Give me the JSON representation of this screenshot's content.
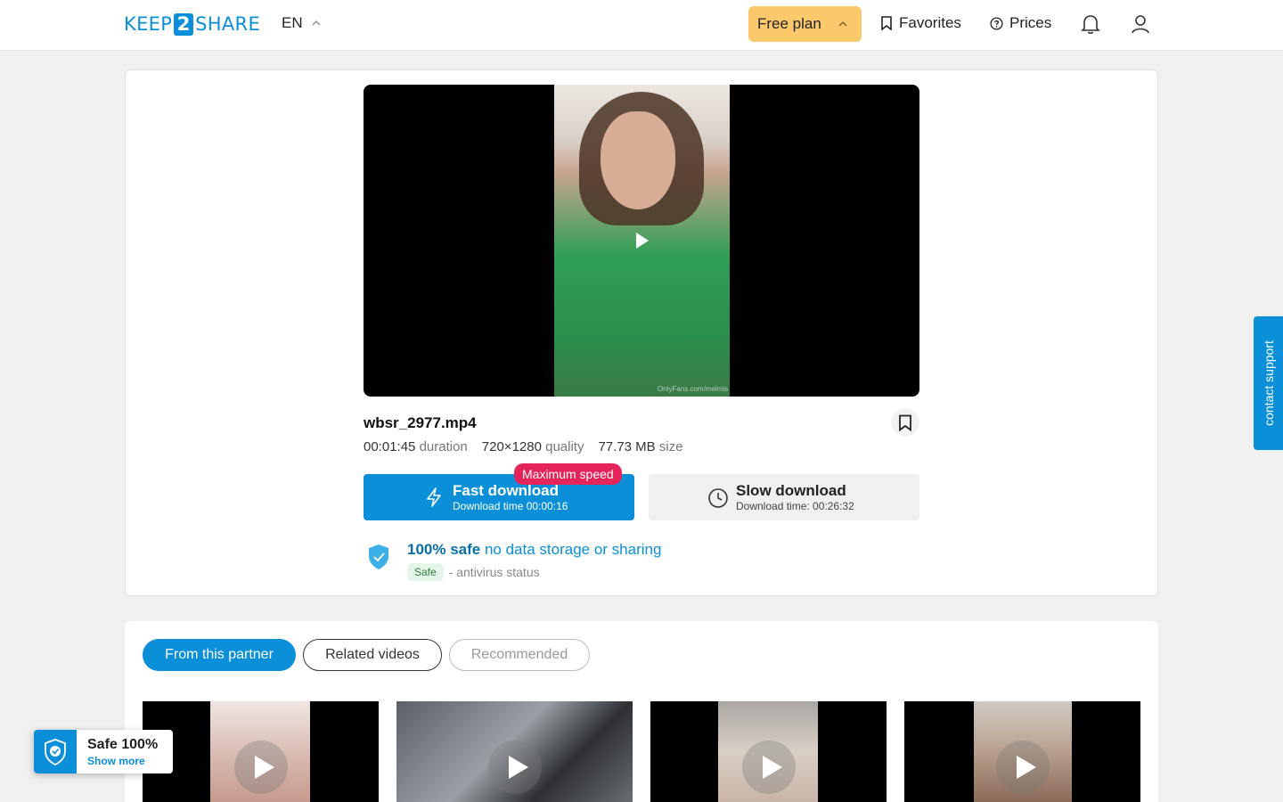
{
  "header": {
    "logo_left": "KEEP",
    "logo_mid": "2",
    "logo_right": "SHARE",
    "language": "EN",
    "plan_label": "Free plan",
    "favorites_label": "Favorites",
    "prices_label": "Prices"
  },
  "file": {
    "name": "wbsr_2977.mp4",
    "duration_value": "00:01:45",
    "duration_label": "duration",
    "quality_value": "720×1280",
    "quality_label": "quality",
    "size_value": "77.73 MB",
    "size_label": "size",
    "watermark": "OnlyFans.com/melmis"
  },
  "download": {
    "fast_title": "Fast download",
    "fast_time": "Download time 00:00:16",
    "max_speed_badge": "Maximum speed",
    "slow_title": "Slow download",
    "slow_time": "Download time: 00:26:32"
  },
  "safety": {
    "safe_bold": "100% safe",
    "safe_text": "no data storage or sharing",
    "status_pill": "Safe",
    "status_text": "- antivirus status"
  },
  "related": {
    "tabs": [
      {
        "label": "From this partner",
        "active": true
      },
      {
        "label": "Related videos",
        "active": false
      },
      {
        "label": "Recommended",
        "active": false
      }
    ]
  },
  "support": {
    "label": "contact support"
  },
  "safe_widget": {
    "title": "Safe 100%",
    "link": "Show more"
  },
  "colors": {
    "brand": "#0b8fd8",
    "plan": "#fbc96b",
    "badge": "#e5245a"
  }
}
